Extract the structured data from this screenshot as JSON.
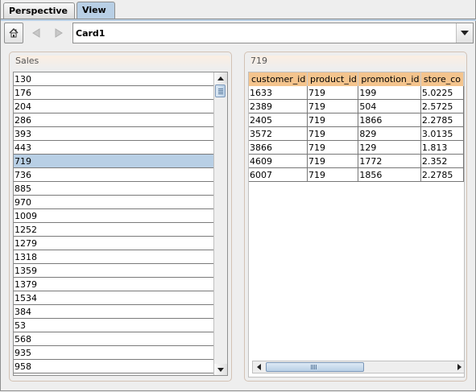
{
  "tabs": [
    {
      "label": "Perspective",
      "active": false
    },
    {
      "label": "View",
      "active": true
    }
  ],
  "toolbar": {
    "home_icon": "home-icon",
    "back_icon": "back-arrow-icon",
    "forward_icon": "forward-arrow-icon",
    "card_selector": {
      "value": "Card1",
      "icon": "chevron-down-icon"
    }
  },
  "left_panel": {
    "title": "Sales",
    "items": [
      "130",
      "176",
      "204",
      "286",
      "393",
      "443",
      "719",
      "736",
      "885",
      "970",
      "1009",
      "1252",
      "1279",
      "1318",
      "1359",
      "1379",
      "1534",
      "384",
      "53",
      "568",
      "935",
      "958"
    ],
    "selected": "719"
  },
  "right_panel": {
    "title": "719",
    "columns": [
      "customer_id",
      "product_id",
      "promotion_id",
      "store_co"
    ],
    "rows": [
      [
        "1633",
        "719",
        "199",
        "5.0225"
      ],
      [
        "2389",
        "719",
        "504",
        "2.5725"
      ],
      [
        "2405",
        "719",
        "1866",
        "2.2785"
      ],
      [
        "3572",
        "719",
        "829",
        "3.0135"
      ],
      [
        "3866",
        "719",
        "129",
        "1.813"
      ],
      [
        "4609",
        "719",
        "1772",
        "2.352"
      ],
      [
        "6007",
        "719",
        "1856",
        "2.2785"
      ]
    ]
  },
  "colors": {
    "accent": "#b8cfe5",
    "header": "#f4c48d",
    "panel_border": "#d3c2b4"
  }
}
